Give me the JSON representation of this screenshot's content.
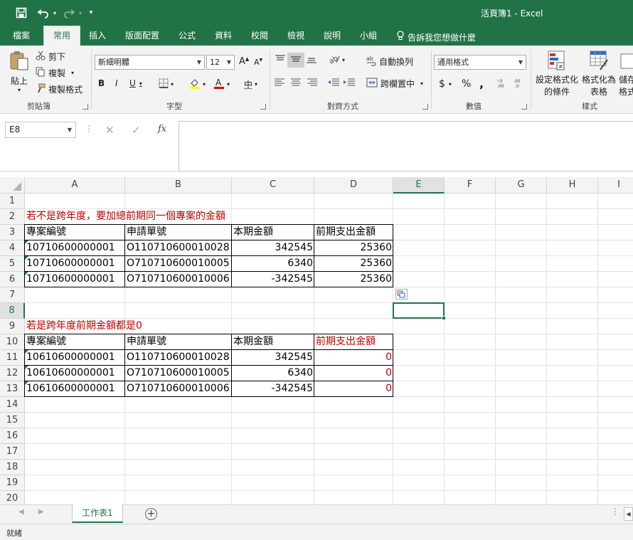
{
  "window": {
    "title": "活頁簿1  -  Excel"
  },
  "quick_access": {
    "save_icon": "save-icon",
    "undo_icon": "undo-icon",
    "redo_icon": "redo-icon",
    "customize_icon": "customize-qat-icon"
  },
  "menu": {
    "tabs": [
      "檔案",
      "常用",
      "插入",
      "版面配置",
      "公式",
      "資料",
      "校閱",
      "檢視",
      "說明",
      "小組"
    ],
    "active": "常用",
    "tell_me": "告訴我您想做什麼"
  },
  "ribbon": {
    "clipboard": {
      "label": "剪貼簿",
      "paste": "貼上",
      "cut": "剪下",
      "copy": "複製",
      "format_painter": "複製格式"
    },
    "font": {
      "label": "字型",
      "name": "新細明體",
      "size": "12",
      "bold": "B",
      "italic": "I",
      "underline": "U",
      "grow": "A",
      "shrink": "A",
      "phonetic": "中"
    },
    "alignment": {
      "label": "對齊方式",
      "wrap": "自動換列",
      "merge": "跨欄置中"
    },
    "number": {
      "label": "數值",
      "format": "通用格式",
      "currency": "$",
      "percent": "%",
      "comma": ","
    },
    "styles": {
      "label": "樣式",
      "conditional": [
        "設定格式化",
        "的條件"
      ],
      "format_table": [
        "格式化為",
        "表格"
      ],
      "cell_styles": [
        "儲存",
        "格式"
      ]
    }
  },
  "formula_bar": {
    "name_box": "E8",
    "fx": "fx",
    "value": ""
  },
  "grid": {
    "columns": [
      "A",
      "B",
      "C",
      "D",
      "E",
      "F",
      "G",
      "H",
      "I"
    ],
    "selected_column": "E",
    "rows": [
      "1",
      "2",
      "3",
      "4",
      "5",
      "6",
      "7",
      "8",
      "9",
      "10",
      "11",
      "12",
      "13",
      "14",
      "15",
      "16",
      "17",
      "18",
      "19",
      "20"
    ],
    "selected_row": "8",
    "active_cell": "E8"
  },
  "sheet": {
    "note1": "若不是跨年度，要加總前期同一個專案的金額",
    "table1": {
      "headers": [
        "專案編號",
        "申請單號",
        "本期金額",
        "前期支出金額"
      ],
      "rows": [
        [
          "10710600000001",
          "O110710600010028",
          "342545",
          "25360"
        ],
        [
          "10710600000001",
          "O710710600010005",
          "6340",
          "25360"
        ],
        [
          "10710600000001",
          "O710710600010006",
          "-342545",
          "25360"
        ]
      ]
    },
    "note2": "若是跨年度前期金額都是0",
    "table2": {
      "headers": [
        "專案編號",
        "申請單號",
        "本期金額",
        "前期支出金額"
      ],
      "rows": [
        [
          "10610600000001",
          "O110710600010028",
          "342545",
          "0"
        ],
        [
          "10610600000001",
          "O710710600010005",
          "6340",
          "0"
        ],
        [
          "10610600000001",
          "O710710600010006",
          "-342545",
          "0"
        ]
      ]
    }
  },
  "colors": {
    "accent": "#217346",
    "note_red": "#c00000"
  },
  "sheet_tabs": {
    "active": "工作表1",
    "add_icon": "add-sheet-icon"
  },
  "status_bar": {
    "text": "就緒"
  }
}
